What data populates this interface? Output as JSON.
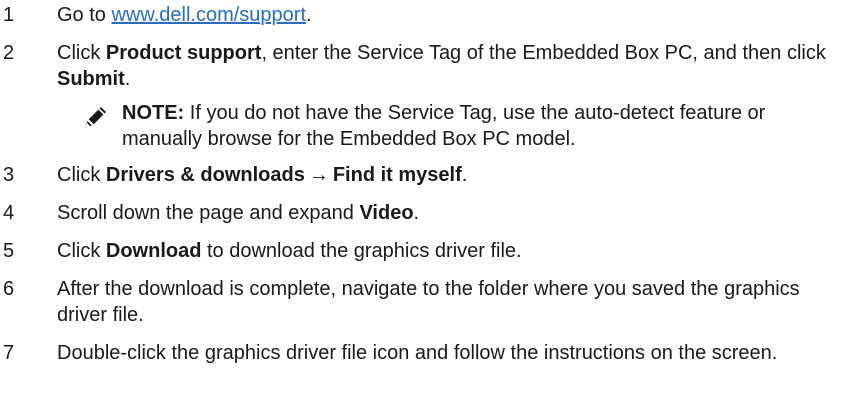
{
  "steps": [
    {
      "num": "1",
      "pre": "Go to ",
      "link": "www.dell.com/support",
      "post": "."
    },
    {
      "num": "2",
      "pre": "Click ",
      "bold1": "Product support",
      "mid": ", enter the Service Tag of the Embedded Box PC, and then click ",
      "bold2": "Submit",
      "post": "."
    },
    {
      "num": "3",
      "pre": "Click ",
      "bold1": "Drivers & downloads",
      "arrow": "→",
      "bold2": "Find it myself",
      "post": "."
    },
    {
      "num": "4",
      "pre": "Scroll down the page and expand ",
      "bold1": "Video",
      "post": "."
    },
    {
      "num": "5",
      "pre": "Click ",
      "bold1": "Download",
      "post": " to download the graphics driver file."
    },
    {
      "num": "6",
      "text": "After the download is complete, navigate to the folder where you saved the graphics driver file."
    },
    {
      "num": "7",
      "text": "Double-click the graphics driver file icon and follow the instructions on the screen."
    }
  ],
  "note": {
    "icon": "pencil-note-icon",
    "label": "NOTE:",
    "text": " If you do not have the Service Tag, use the auto-detect feature or manually browse for the Embedded Box PC model."
  }
}
